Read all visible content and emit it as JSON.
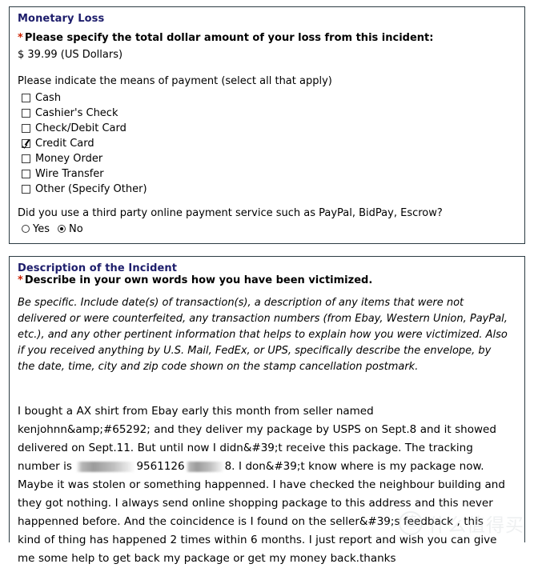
{
  "monetary": {
    "section_title": "Monetary Loss",
    "asterisk": "*",
    "required_question": "Please specify the total dollar amount of your loss from this incident:",
    "amount_text": "$ 39.99 (US Dollars)",
    "payment_intro": "Please indicate the means of payment (select all that apply)",
    "payment_options": [
      {
        "label": "Cash",
        "checked": false
      },
      {
        "label": "Cashier's Check",
        "checked": false
      },
      {
        "label": "Check/Debit Card",
        "checked": false
      },
      {
        "label": "Credit Card",
        "checked": true
      },
      {
        "label": "Money Order",
        "checked": false
      },
      {
        "label": "Wire Transfer",
        "checked": false
      },
      {
        "label": "Other (Specify Other)",
        "checked": false
      }
    ],
    "third_party_question": "Did you use a third party online payment service such as PayPal, BidPay, Escrow?",
    "radio_options": [
      {
        "label": "Yes",
        "selected": false
      },
      {
        "label": "No",
        "selected": true
      }
    ]
  },
  "description": {
    "section_title": "Description of the Incident",
    "asterisk": "*",
    "required_question": "Describe in your own words how you have been victimized.",
    "instructions": "Be specific. Include date(s) of transaction(s), a description of any items that were not delivered or were counterfeited, any transaction numbers (from Ebay, Western Union, PayPal, etc.), and any other pertinent information that helps to explain how you were victimized. Also if you received anything by U.S. Mail, FedEx, or UPS, specifically describe the envelope, by the date, time, city and zip code shown on the stamp cancellation postmark.",
    "narrative_part1": "I bought a AX shirt from Ebay early this month from seller named kenjohnn&amp;#65292; and they deliver my package by USPS on Sept.8 and it showed delivered on Sept.11. But until now I didn&#39;t receive this package. The tracking number is ",
    "narrative_tracking_visible": "9561126",
    "narrative_part2": "8. I don&#39;t know where is my package now. Maybe it was stolen or something happenned. I have checked the neighbour building and they got nothing. I always send online shopping package to this address and this never happenned before. And the coincidence is I found on the seller&#39;s feedback , this kind of thing has happened 2 times within 6 months. I just report and wish you can give me some help to get back my package or get my money back.thanks"
  },
  "watermark": {
    "badge": "值",
    "text": "什么值得买"
  },
  "colors": {
    "section_title": "#1d1d6b",
    "asterisk": "#cc2200",
    "panel_border": "#2c3b43",
    "body_text": "#000000",
    "page_background": "#ffffff"
  }
}
